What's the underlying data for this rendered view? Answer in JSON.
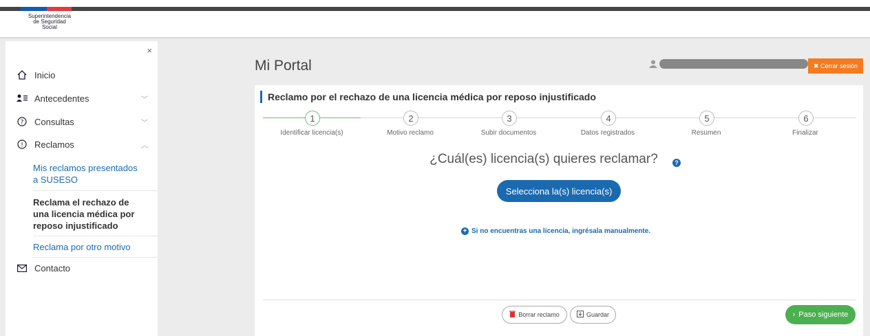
{
  "header": {
    "logo_line1": "Superintendencia",
    "logo_line2": "de Seguridad",
    "logo_line3": "Social"
  },
  "sidebar": {
    "close": "×",
    "items": [
      {
        "label": "Inicio",
        "icon": "home-icon"
      },
      {
        "label": "Antecedentes",
        "icon": "user-list-icon"
      },
      {
        "label": "Consultas",
        "icon": "question-icon"
      },
      {
        "label": "Reclamos",
        "icon": "exclamation-icon"
      },
      {
        "label": "Contacto",
        "icon": "envelope-icon"
      }
    ],
    "sub_items": [
      {
        "label": "Mis reclamos presentados a SUSESO"
      },
      {
        "label": "Reclama el rechazo de una licencia médica por reposo injustificado"
      },
      {
        "label": "Reclama por otro motivo"
      }
    ]
  },
  "main": {
    "title": "Mi Portal",
    "logout_label": "✖ Cerrar sesión",
    "card_title": "Reclamo por el rechazo de una licencia médica por reposo injustificado",
    "steps": [
      {
        "num": "1",
        "label": "Identificar licencia(s)"
      },
      {
        "num": "2",
        "label": "Motivo reclamo"
      },
      {
        "num": "3",
        "label": "Subir documentos"
      },
      {
        "num": "4",
        "label": "Datos registrados"
      },
      {
        "num": "5",
        "label": "Resumen"
      },
      {
        "num": "6",
        "label": "Finalizar"
      }
    ],
    "question": "¿Cuál(es) licencia(s) quieres reclamar?",
    "help": "?",
    "select_button": "Selecciona la(s) licencia(s)",
    "manual_link": "Si no encuentras una licencia, ingrésala manualmente.",
    "delete_button": "Borrar reclamo",
    "save_button": "Guardar",
    "next_button": "Paso siguiente"
  },
  "colors": {
    "accent_blue": "#1b6ab0",
    "logout_orange": "#f47b20",
    "next_green": "#4caf50",
    "step_green": "#6cbf6b"
  }
}
